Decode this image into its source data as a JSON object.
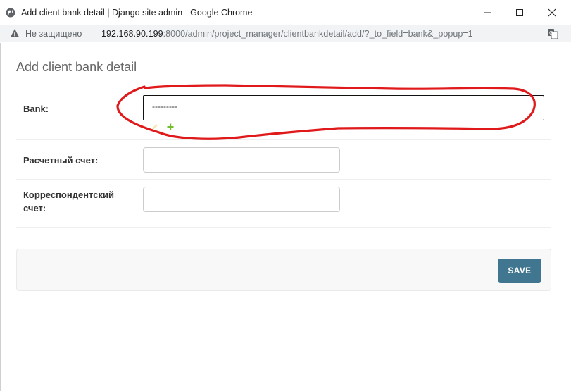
{
  "window": {
    "title": "Add client bank detail | Django site admin - Google Chrome"
  },
  "addressbar": {
    "security_label": "Не защищено",
    "url_host": "192.168.90.199",
    "url_path": ":8000/admin/project_manager/clientbankdetail/add/?_to_field=bank&_popup=1"
  },
  "page": {
    "title": "Add client bank detail"
  },
  "form": {
    "bank": {
      "label": "Bank:",
      "selected_value": "---------"
    },
    "settlement_account": {
      "label": "Расчетный счет:",
      "value": ""
    },
    "correspondent_account": {
      "label": "Корреспондентский счет:",
      "value": ""
    }
  },
  "submit": {
    "save_label": "SAVE"
  },
  "colors": {
    "save_button": "#417690",
    "annotation_stroke": "#e0191b",
    "add_related": "#70bf2b"
  }
}
